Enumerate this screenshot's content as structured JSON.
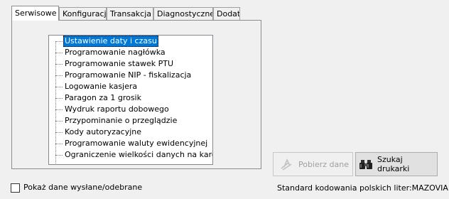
{
  "tabs": [
    {
      "label": "Serwisowe",
      "active": true
    },
    {
      "label": "Konfiguracja",
      "active": false
    },
    {
      "label": "Transakcja",
      "active": false
    },
    {
      "label": "Diagnostyczne",
      "active": false
    },
    {
      "label": "Dodat",
      "active": false
    }
  ],
  "tree": {
    "items": [
      {
        "label": "Ustawienie daty i czasu",
        "selected": true
      },
      {
        "label": "Programowanie nagłówka",
        "selected": false
      },
      {
        "label": "Programowanie stawek PTU",
        "selected": false
      },
      {
        "label": "Programowanie NIP - fiskalizacja",
        "selected": false
      },
      {
        "label": "Logowanie kasjera",
        "selected": false
      },
      {
        "label": "Paragon za 1 grosik",
        "selected": false
      },
      {
        "label": "Wydruk raportu dobowego",
        "selected": false
      },
      {
        "label": "Przypominanie o przeglądzie",
        "selected": false
      },
      {
        "label": "Kody autoryzacyjne",
        "selected": false
      },
      {
        "label": "Programowanie waluty ewidencyjnej",
        "selected": false
      },
      {
        "label": "Ograniczenie wielkości danych na karcie",
        "selected": false
      }
    ]
  },
  "buttons": {
    "pobierz": {
      "label": "Pobierz dane",
      "enabled": false
    },
    "szukaj": {
      "label": "Szukaj drukarki",
      "enabled": true
    }
  },
  "checkbox": {
    "label": "Pokaż dane wysłane/odebrane",
    "checked": false
  },
  "status": {
    "encoding": "Standard kodowania polskich liter:MAZOVIA"
  }
}
